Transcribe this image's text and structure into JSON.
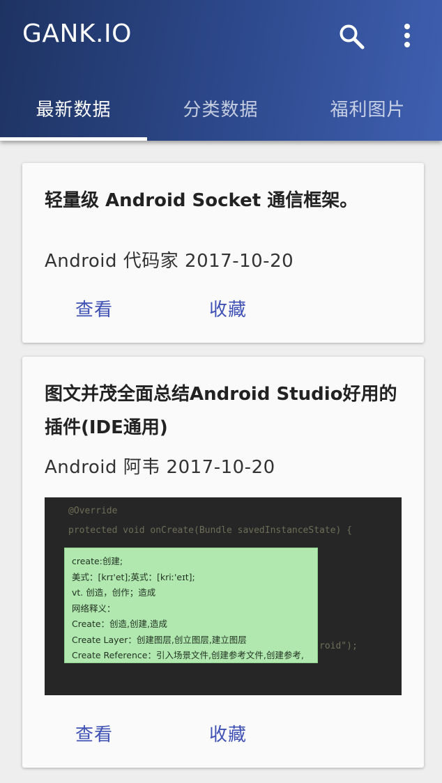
{
  "appbar": {
    "title": "GANK.IO",
    "search_icon": "search-icon",
    "more_icon": "more-vert-icon"
  },
  "tabs": [
    {
      "label": "最新数据",
      "active": true
    },
    {
      "label": "分类数据",
      "active": false
    },
    {
      "label": "福利图片",
      "active": false
    }
  ],
  "cards": [
    {
      "title": "轻量级 Android Socket 通信框架。",
      "meta": "Android 代码家 2017-10-20",
      "view_label": "查看",
      "collect_label": "收藏"
    },
    {
      "title": "图文并茂全面总结Android Studio好用的插件(IDE通用)",
      "meta": "Android 阿韦 2017-10-20",
      "view_label": "查看",
      "collect_label": "收藏",
      "image": {
        "code_lines": [
          "@Override",
          "protected void onCreate(Bundle savedInstanceState) {"
        ],
        "code_tail": "roid\");",
        "popup_lines": [
          "create:创建;",
          "美式：[krɪ'et];英式：[kriː'eɪt];",
          "vt. 创造，创作；造成",
          "网络释义：",
          "Create：创造,创建,造成",
          "Create Layer：创建图层,创立图层,建立图层",
          "Create Reference：引入场景文件,创建参考文件,创建参考,"
        ]
      }
    }
  ],
  "colors": {
    "appbar_start": "#1e3362",
    "appbar_end": "#3f5fb0",
    "accent": "#3f51b5",
    "popup_bg": "#b1e8b0"
  }
}
